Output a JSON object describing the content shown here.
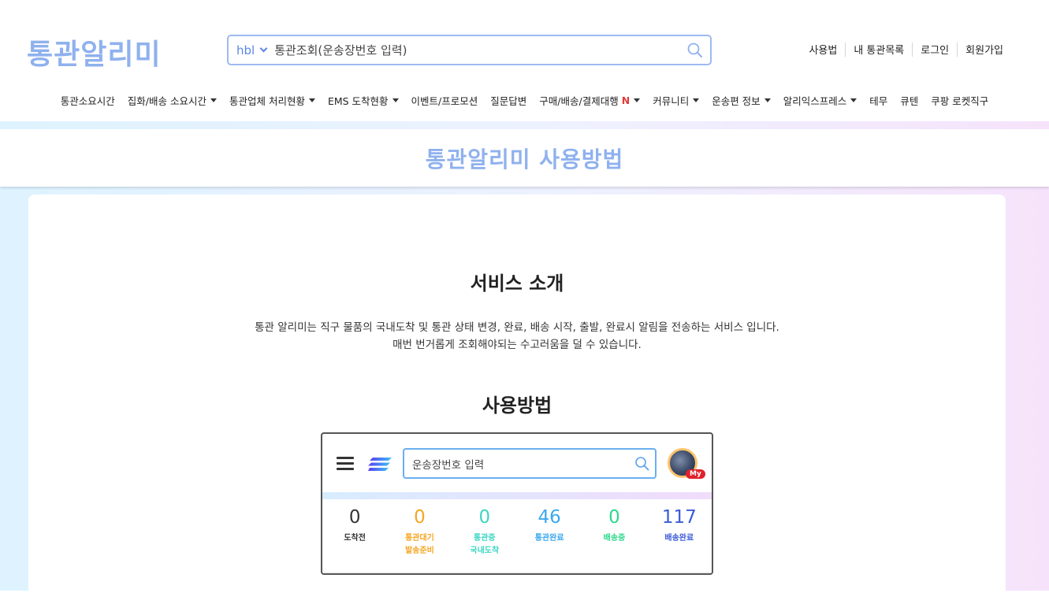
{
  "header": {
    "logo": "통관알리미",
    "search": {
      "type": "hbl",
      "placeholder": "통관조회(운송장번호 입력)"
    },
    "links": [
      "사용법",
      "내 통관목록",
      "로그인",
      "회원가입"
    ]
  },
  "nav": {
    "items": [
      {
        "label": "통관소요시간",
        "dropdown": false
      },
      {
        "label": "집화/배송 소요시간",
        "dropdown": true
      },
      {
        "label": "통관업체 처리현황",
        "dropdown": true
      },
      {
        "label": "EMS 도착현황",
        "dropdown": true
      },
      {
        "label": "이벤트/프로모션",
        "dropdown": false
      },
      {
        "label": "질문답변",
        "dropdown": false
      },
      {
        "label": "구매/배송/결제대행",
        "dropdown": true,
        "badge": "N"
      },
      {
        "label": "커뮤니티",
        "dropdown": true
      },
      {
        "label": "운송편 정보",
        "dropdown": true
      },
      {
        "label": "알리익스프레스",
        "dropdown": true
      },
      {
        "label": "테무",
        "dropdown": false
      },
      {
        "label": "큐텐",
        "dropdown": false
      },
      {
        "label": "쿠팡 로켓직구",
        "dropdown": false
      }
    ]
  },
  "page": {
    "title": "통관알리미 사용방법",
    "service_title": "서비스 소개",
    "intro_line1": "통관 알리미는 직구 물품의 국내도착 및 통관 상태 변경, 완료, 배송 시작, 출발, 완료시 알림을 전송하는 서비스 입니다.",
    "intro_line2": "매번 번거롭게 조회해야되는 수고러움을 덜 수 있습니다.",
    "usage_title": "사용방법"
  },
  "demo": {
    "search_placeholder": "운송장번호 입력",
    "my_badge": "My",
    "stats": [
      {
        "value": "0",
        "label1": "도착전",
        "label2": "",
        "color": "#333333"
      },
      {
        "value": "0",
        "label1": "통관대기",
        "label2": "발송준비",
        "color": "#f5a623"
      },
      {
        "value": "0",
        "label1": "통관중",
        "label2": "국내도착",
        "color": "#3dd6c2"
      },
      {
        "value": "46",
        "label1": "통관완료",
        "label2": "",
        "color": "#3aa8ef"
      },
      {
        "value": "0",
        "label1": "배송중",
        "label2": "",
        "color": "#2ed88e"
      },
      {
        "value": "117",
        "label1": "배송완료",
        "label2": "",
        "color": "#3b5bd9"
      }
    ]
  },
  "colors": {
    "brand": "#8fb1ee",
    "search_border": "#9dbaf1",
    "accent_red": "#e53935"
  }
}
